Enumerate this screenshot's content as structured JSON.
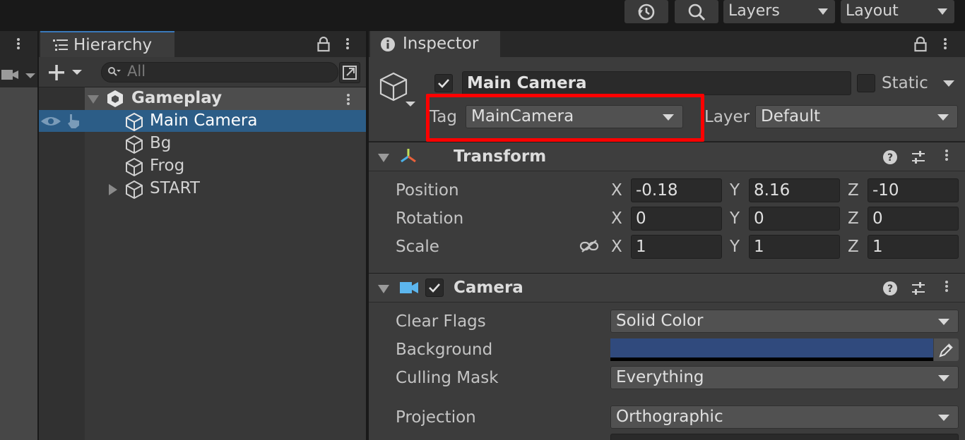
{
  "toolbar": {
    "history_icon": "history-icon",
    "search_icon": "search-icon",
    "layers_label": "Layers",
    "layout_label": "Layout"
  },
  "hierarchy": {
    "tab_label": "Hierarchy",
    "search_placeholder": "All",
    "scene_name": "Gameplay",
    "items": [
      {
        "label": "Main Camera",
        "selected": true
      },
      {
        "label": "Bg"
      },
      {
        "label": "Frog"
      },
      {
        "label": "START",
        "expandable": true
      }
    ]
  },
  "inspector": {
    "tab_label": "Inspector",
    "object_name": "Main Camera",
    "static_label": "Static",
    "tag_label": "Tag",
    "tag_value": "MainCamera",
    "layer_label": "Layer",
    "layer_value": "Default",
    "transform": {
      "title": "Transform",
      "position_label": "Position",
      "rotation_label": "Rotation",
      "scale_label": "Scale",
      "axis_x": "X",
      "axis_y": "Y",
      "axis_z": "Z",
      "position": [
        "-0.18",
        "8.16",
        "-10"
      ],
      "rotation": [
        "0",
        "0",
        "0"
      ],
      "scale": [
        "1",
        "1",
        "1"
      ]
    },
    "camera": {
      "title": "Camera",
      "clear_flags_label": "Clear Flags",
      "clear_flags_value": "Solid Color",
      "background_label": "Background",
      "background_color": "#304a7d",
      "culling_mask_label": "Culling Mask",
      "culling_mask_value": "Everything",
      "projection_label": "Projection",
      "projection_value": "Orthographic"
    }
  },
  "colors": {
    "selection": "#2c5d87",
    "highlight_box": "#ff0000"
  }
}
